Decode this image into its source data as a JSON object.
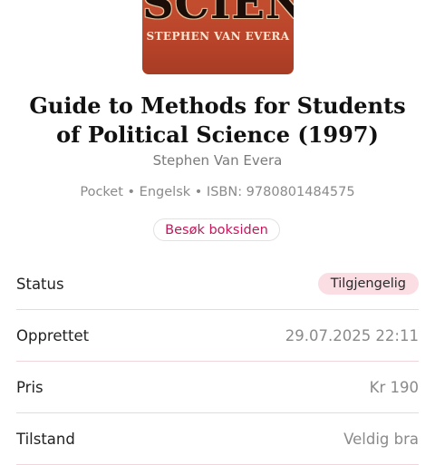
{
  "book": {
    "cover_word": "SCIENCE",
    "cover_author": "STEPHEN VAN EVERA",
    "title": "Guide to Methods for Students of Political Science (1997)",
    "author": "Stephen Van Evera",
    "meta": "Pocket • Engelsk • ISBN: 9780801484575",
    "visit_button": "Besøk boksiden"
  },
  "details": [
    {
      "label": "Status",
      "value": "Tilgjengelig"
    },
    {
      "label": "Opprettet",
      "value": "29.07.2025 22:11"
    },
    {
      "label": "Pris",
      "value": "Kr 190"
    },
    {
      "label": "Tilstand",
      "value": "Veldig bra"
    }
  ],
  "colors": {
    "accent": "#c2185b",
    "badge_bg": "#fbdde4",
    "divider": "#f0d6dc",
    "cover": "#b8442a"
  }
}
